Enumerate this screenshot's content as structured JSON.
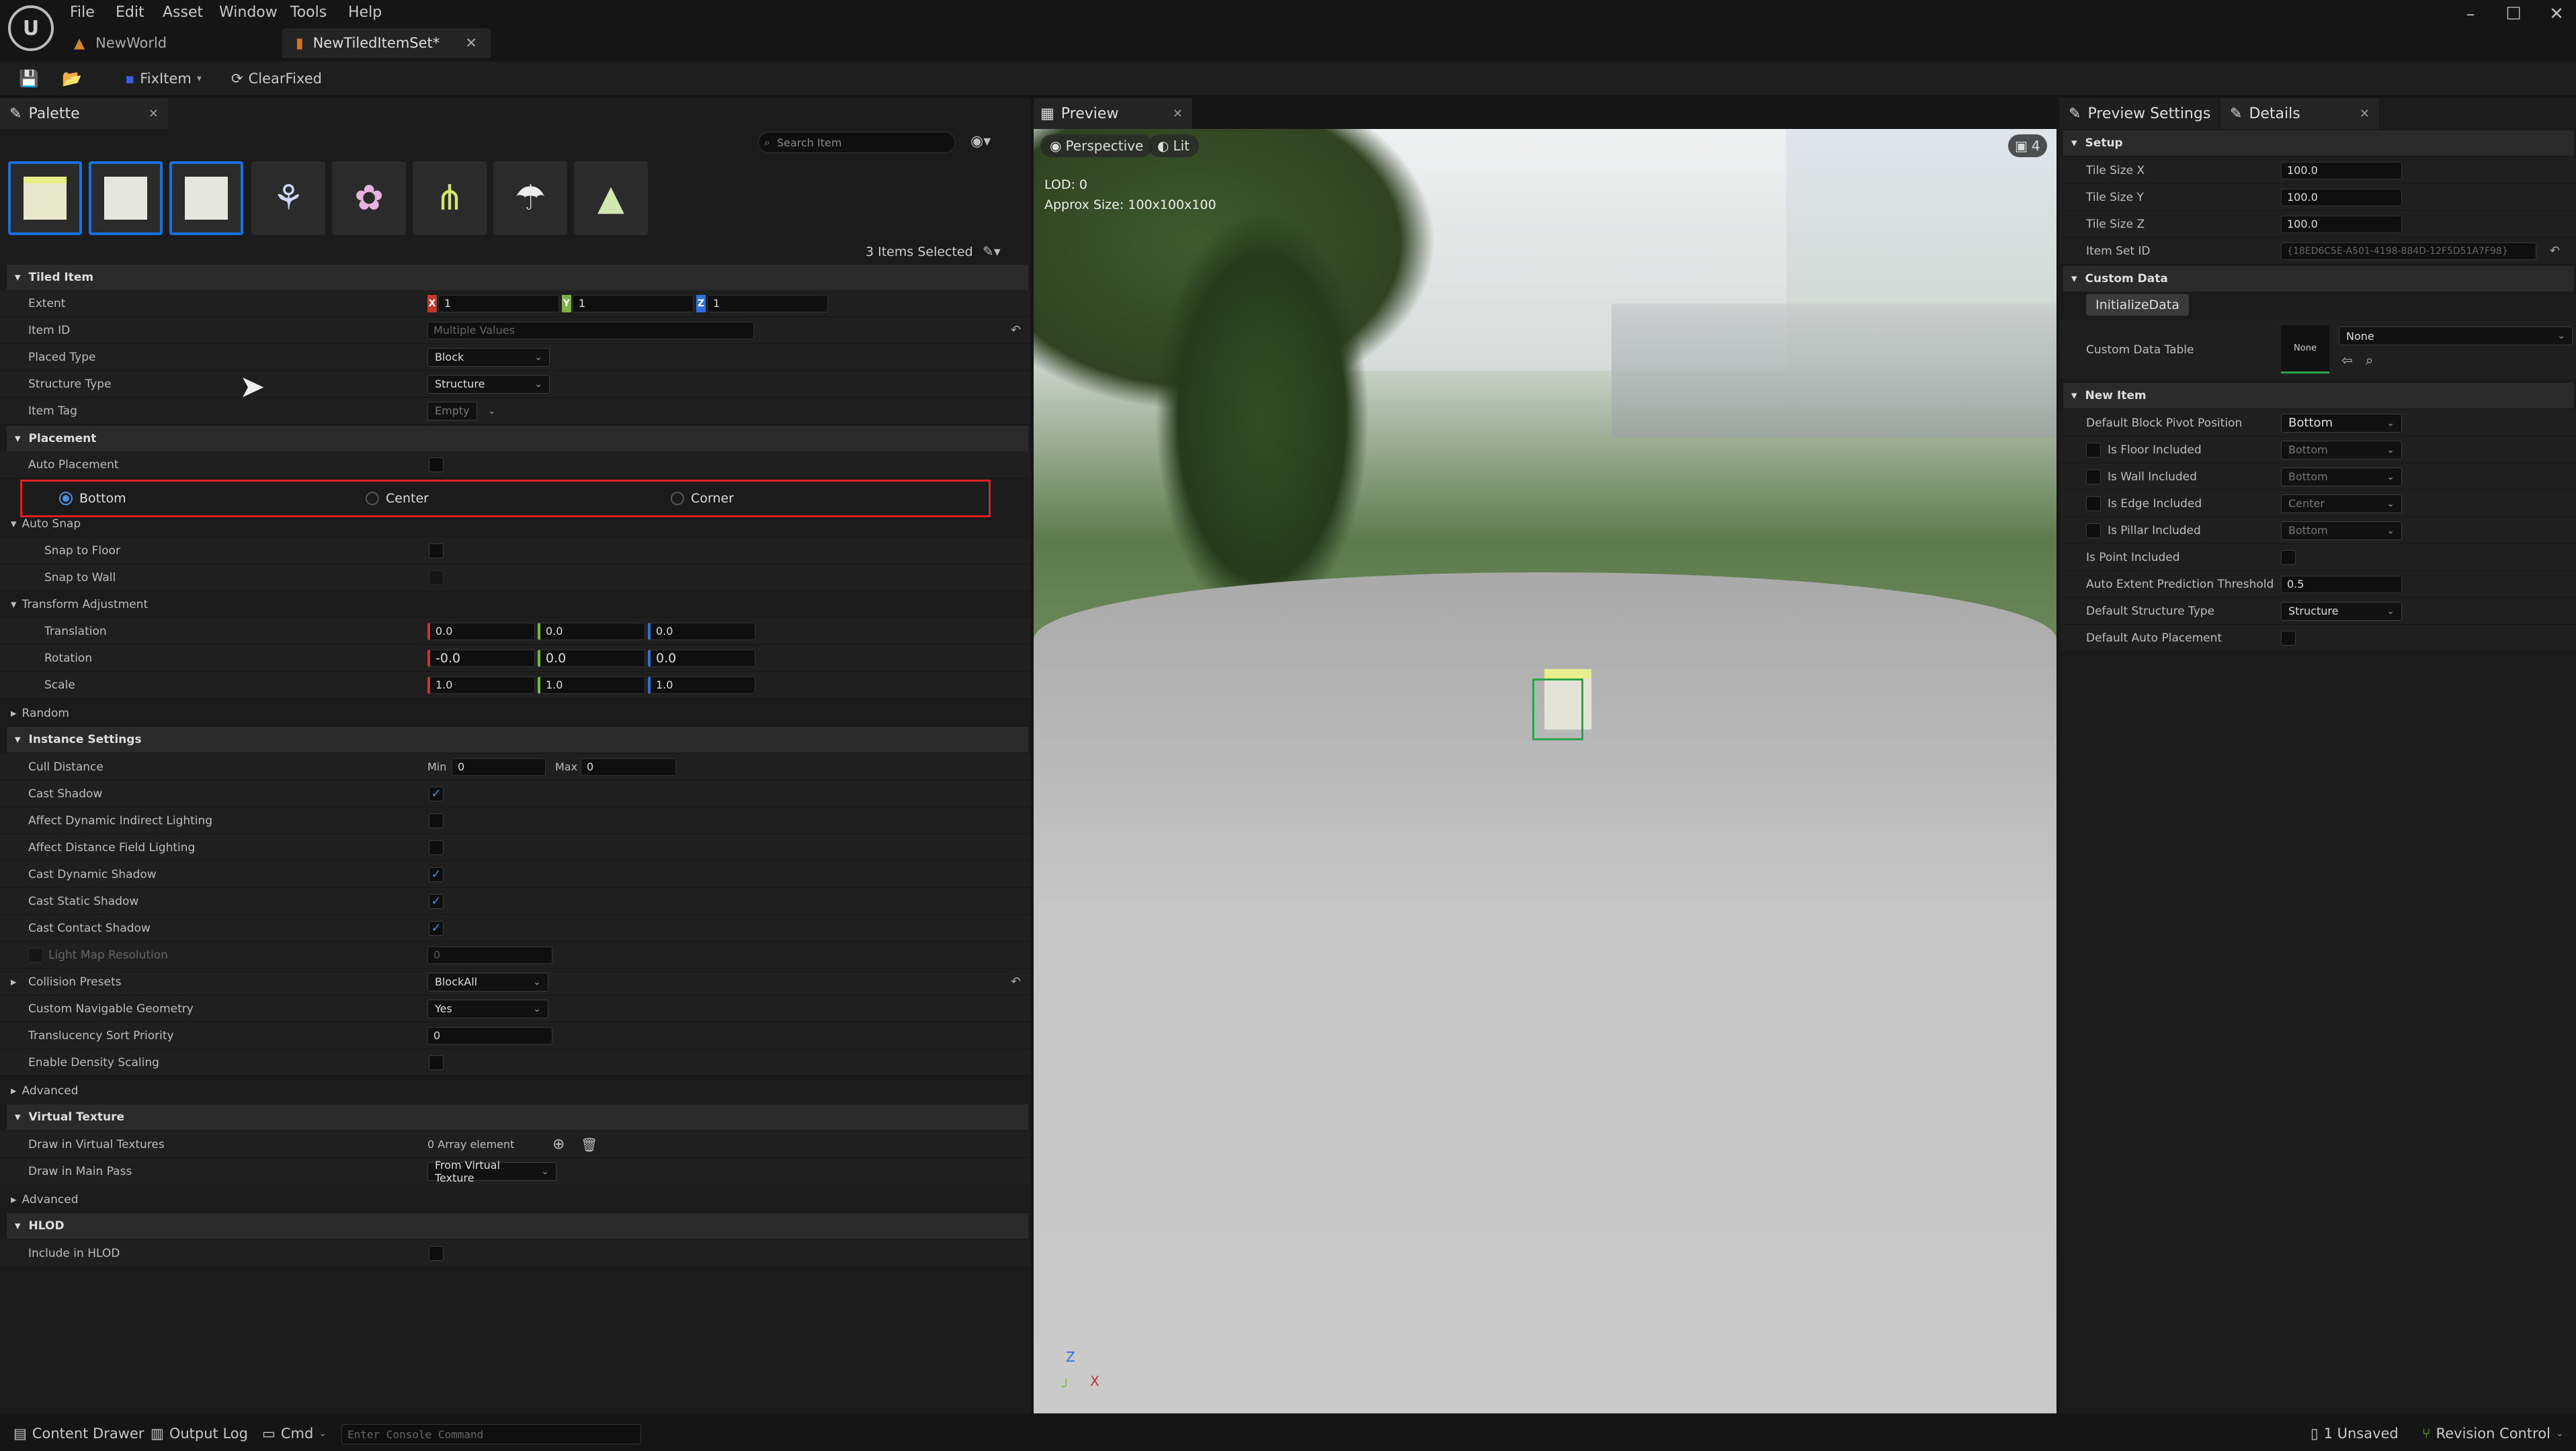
{
  "app": {
    "logo": "U"
  },
  "menu": [
    "File",
    "Edit",
    "Asset",
    "Window",
    "Tools",
    "Help"
  ],
  "doc_tabs": [
    {
      "label": "NewWorld"
    },
    {
      "label": "NewTiledItemSet*"
    }
  ],
  "toolbar": {
    "fix_item": "FixItem",
    "clear_fixed": "ClearFixed"
  },
  "palette": {
    "tab_label": "Palette",
    "search_placeholder": "Search Item",
    "items_selected": "3 Items Selected",
    "thumbnails": [
      "cube-icon",
      "cube-icon",
      "cube-icon",
      "plant-icon",
      "flower-icon",
      "grass-icon",
      "mushroom-icon",
      "tree-icon"
    ]
  },
  "tiled_item": {
    "section": "Tiled Item",
    "extent_label": "Extent",
    "extent": {
      "x": "1",
      "y": "1",
      "z": "1"
    },
    "item_id_label": "Item ID",
    "item_id_value": "Multiple Values",
    "placed_type_label": "Placed Type",
    "placed_type": "Block",
    "structure_type_label": "Structure Type",
    "structure_type": "Structure",
    "item_tag_label": "Item Tag",
    "item_tag": "Empty"
  },
  "placement": {
    "section": "Placement",
    "auto_placement_label": "Auto Placement",
    "options": [
      "Bottom",
      "Center",
      "Corner"
    ],
    "selected": "Bottom"
  },
  "auto_snap": {
    "section": "Auto Snap",
    "snap_floor": "Snap to Floor",
    "snap_wall": "Snap to Wall"
  },
  "transform": {
    "section": "Transform Adjustment",
    "translation_label": "Translation",
    "translation": [
      "0.0",
      "0.0",
      "0.0"
    ],
    "rotation_label": "Rotation",
    "rotation": [
      "-0.0",
      "0.0",
      "0.0"
    ],
    "scale_label": "Scale",
    "scale": [
      "1.0",
      "1.0",
      "1.0"
    ]
  },
  "random": {
    "section": "Random"
  },
  "instance": {
    "section": "Instance Settings",
    "cull_label": "Cull Distance",
    "cull_min_label": "Min",
    "cull_min": "0",
    "cull_max_label": "Max",
    "cull_max": "0",
    "cast_shadow": "Cast Shadow",
    "affect_dyn": "Affect Dynamic Indirect Lighting",
    "affect_dist": "Affect Distance Field Lighting",
    "cast_dyn": "Cast Dynamic Shadow",
    "cast_static": "Cast Static Shadow",
    "cast_contact": "Cast Contact Shadow",
    "light_map": "Light Map Resolution",
    "light_map_value": "0",
    "collision_label": "Collision Presets",
    "collision": "BlockAll",
    "nav_label": "Custom Navigable Geometry",
    "nav": "Yes",
    "sort_label": "Translucency Sort Priority",
    "sort": "0",
    "density_label": "Enable Density Scaling"
  },
  "advanced1": {
    "section": "Advanced"
  },
  "virtual_texture": {
    "section": "Virtual Texture",
    "draw_vt_label": "Draw in Virtual Textures",
    "draw_vt_value": "0 Array element",
    "draw_main_label": "Draw in Main Pass",
    "draw_main": "From Virtual Texture"
  },
  "advanced2": {
    "section": "Advanced"
  },
  "hlod": {
    "section": "HLOD",
    "include_label": "Include in HLOD"
  },
  "preview": {
    "tab_label": "Preview",
    "perspective": "Perspective",
    "lit": "Lit",
    "cam_speed": "4",
    "lod": "LOD: 0",
    "approx": "Approx Size: 100x100x100",
    "axis_z": "Z",
    "axis_x": "X"
  },
  "details": {
    "tab_preview_settings": "Preview Settings",
    "tab_details": "Details",
    "setup": {
      "section": "Setup",
      "tile_x_label": "Tile Size X",
      "tile_x": "100.0",
      "tile_y_label": "Tile Size Y",
      "tile_y": "100.0",
      "tile_z_label": "Tile Size Z",
      "tile_z": "100.0",
      "item_set_id_label": "Item Set ID",
      "item_set_id": "{18ED6C5E-A501-4198-884D-12F5D51A7F98}"
    },
    "custom_data": {
      "section": "Custom Data",
      "init_button": "InitializeData",
      "table_label": "Custom Data Table",
      "table_thumb": "None",
      "table_value": "None"
    },
    "new_item": {
      "section": "New Item",
      "pivot_label": "Default Block Pivot Position",
      "pivot": "Bottom",
      "floor_label": "Is Floor Included",
      "floor": "Bottom",
      "wall_label": "Is Wall Included",
      "wall": "Bottom",
      "edge_label": "Is Edge Included",
      "edge": "Center",
      "pillar_label": "Is Pillar Included",
      "pillar": "Bottom",
      "point_label": "Is Point Included",
      "threshold_label": "Auto Extent Prediction Threshold",
      "threshold": "0.5",
      "structure_label": "Default Structure Type",
      "structure": "Structure",
      "auto_place_label": "Default Auto Placement"
    }
  },
  "bottom": {
    "content_drawer": "Content Drawer",
    "output_log": "Output Log",
    "cmd": "Cmd",
    "console_placeholder": "Enter Console Command",
    "unsaved": "1 Unsaved",
    "revision": "Revision Control"
  },
  "colors": {
    "accent": "#1a6fe0",
    "highlight": "#e02020",
    "x": "#c0392b",
    "y": "#7cb342",
    "z": "#2d6fdc"
  }
}
